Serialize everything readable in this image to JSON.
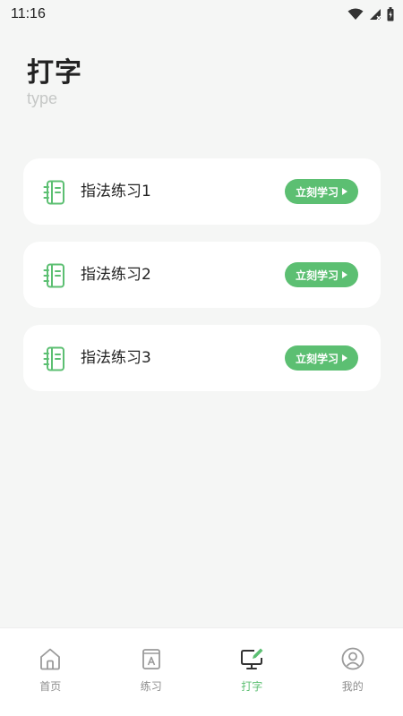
{
  "status_bar": {
    "time": "11:16",
    "icons": [
      "wifi-icon",
      "cell-signal-icon",
      "battery-icon"
    ]
  },
  "header": {
    "title": "打字",
    "subtitle": "type"
  },
  "cards": [
    {
      "label": "指法练习1",
      "button_label": "立刻学习",
      "icon": "notebook-icon"
    },
    {
      "label": "指法练习2",
      "button_label": "立刻学习",
      "icon": "notebook-icon"
    },
    {
      "label": "指法练习3",
      "button_label": "立刻学习",
      "icon": "notebook-icon"
    }
  ],
  "bottom_nav": {
    "items": [
      {
        "label": "首页",
        "icon": "home-icon",
        "active": false
      },
      {
        "label": "练习",
        "icon": "practice-book-icon",
        "active": false
      },
      {
        "label": "打字",
        "icon": "typing-monitor-icon",
        "active": true
      },
      {
        "label": "我的",
        "icon": "profile-icon",
        "active": false
      }
    ]
  },
  "colors": {
    "accent": "#5cbf72",
    "background": "#f5f6f5",
    "card": "#ffffff",
    "inactive_nav": "#8e8e8e"
  }
}
